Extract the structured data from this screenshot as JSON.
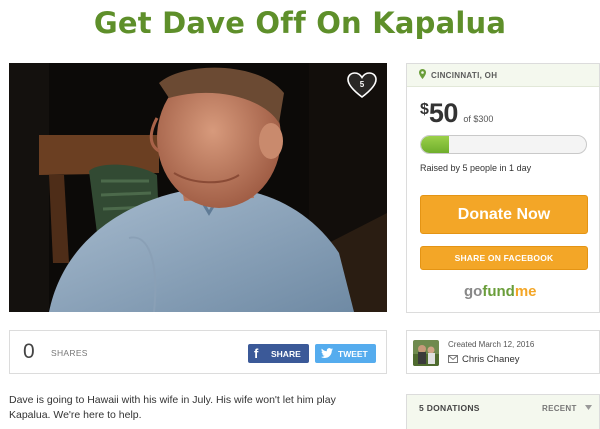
{
  "campaign": {
    "title": "Get Dave Off On Kapalua",
    "hearts": "5",
    "story": "Dave is going to Hawaii with his wife in July. His wife won't let him play Kapalua. We're here to help."
  },
  "sidebar": {
    "location": "CINCINNATI, OH",
    "currency": "$",
    "raised_amount": "50",
    "goal_text": "of $300",
    "progress_fraction": 0.167,
    "raised_by": "Raised by 5 people in 1 day",
    "donate_label": "Donate Now",
    "share_fb_label": "SHARE ON FACEBOOK",
    "logo": {
      "go": "go",
      "fund": "fund",
      "me": "me"
    }
  },
  "shares": {
    "count": "0",
    "label": "SHARES",
    "facebook_label": "SHARE",
    "twitter_label": "TWEET"
  },
  "organizer": {
    "created": "Created March 12, 2016",
    "name": "Chris Chaney"
  },
  "donations": {
    "count_label": "5 DONATIONS",
    "sort_label": "RECENT"
  },
  "colors": {
    "title_green": "#5e8f2a",
    "donate_orange": "#f3a627",
    "progress_green": "#7cbf35",
    "facebook_blue": "#3b5998",
    "twitter_blue": "#55acee"
  },
  "icons": [
    "heart-icon",
    "location-pin-icon",
    "facebook-icon",
    "twitter-icon",
    "mail-icon",
    "chevron-down-icon"
  ]
}
